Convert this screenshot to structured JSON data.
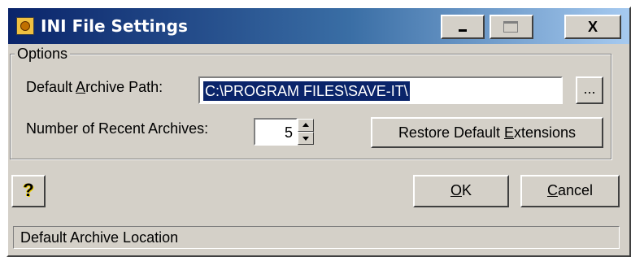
{
  "window": {
    "title": "INI File Settings",
    "icon": "app-gear-icon"
  },
  "titlebar_buttons": {
    "minimize": "_",
    "maximize": "□",
    "close": "X"
  },
  "options": {
    "group_label": "Options",
    "archive_path_label_before": "Default ",
    "archive_path_label_underlined": "A",
    "archive_path_label_after": "rchive Path:",
    "archive_path_value": "C:\\PROGRAM FILES\\SAVE-IT\\",
    "browse_button_label": "...",
    "recent_archives_label": "Number of Recent Archives:",
    "recent_archives_value": "5",
    "restore_button_before": "Restore Default ",
    "restore_button_underlined": "E",
    "restore_button_after": "xtensions"
  },
  "buttons": {
    "help_label": "?",
    "ok_underlined": "O",
    "ok_after": "K",
    "cancel_underlined": "C",
    "cancel_after": "ancel"
  },
  "status": {
    "text": "Default Archive Location"
  },
  "colors": {
    "titlebar_start": "#0a246a",
    "titlebar_end": "#a6caf0",
    "selection": "#0a246a",
    "face": "#d4d0c8"
  }
}
